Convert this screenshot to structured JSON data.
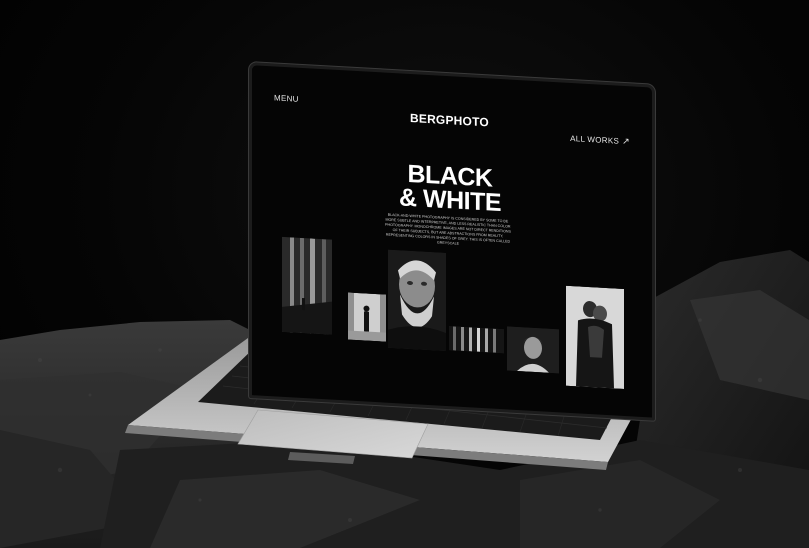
{
  "header": {
    "menu_label": "MENU",
    "brand": "BERGPHOTO",
    "all_works_label": "ALL WORKS",
    "all_works_icon": "arrow-up-right-icon"
  },
  "hero": {
    "title_line1": "BLACK",
    "title_line2": "& WHITE",
    "description": "Black-and-white photography is considered by some to be more subtle and interpretive, and less realistic than color photography. Monochrome images are not direct renditions of their subjects, but are abstractions from reality, representing colors in shades of grey. This is often called greyscale"
  },
  "gallery": {
    "photos": [
      {
        "name": "photo-architecture"
      },
      {
        "name": "photo-corridor-figure"
      },
      {
        "name": "photo-bearded-man-portrait"
      },
      {
        "name": "photo-light-stripes"
      },
      {
        "name": "photo-woman-portrait"
      },
      {
        "name": "photo-couple-embrace"
      }
    ]
  },
  "colors": {
    "background": "#000000",
    "screen": "#050505",
    "text": "#ffffff",
    "laptop_body": "#b9b9b9"
  }
}
